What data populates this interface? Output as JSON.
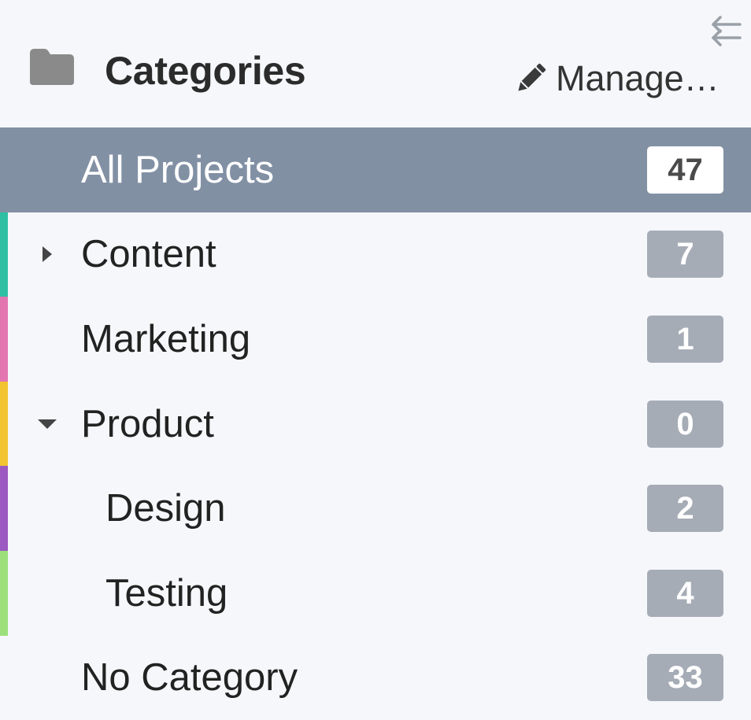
{
  "header": {
    "title": "Categories",
    "manage_label": "Manage…",
    "icons": {
      "folder": "folder-icon",
      "pencil": "pencil-icon",
      "collapse": "collapse-arrows-icon"
    }
  },
  "colors": {
    "background": "#f5f7fa",
    "selected_row": "#8290a4",
    "badge": "#a6acb6",
    "selected_badge": "#ffffff",
    "content": "#2fc0a3",
    "marketing": "#e376b0",
    "product": "#f2c431",
    "design": "#9b59c1",
    "testing": "#9be07a"
  },
  "categories": [
    {
      "label": "All Projects",
      "count": "47",
      "selected": true
    },
    {
      "label": "Content",
      "count": "7",
      "caret": "collapsed"
    },
    {
      "label": "Marketing",
      "count": "1"
    },
    {
      "label": "Product",
      "count": "0",
      "caret": "expanded"
    },
    {
      "label": "Design",
      "count": "2"
    },
    {
      "label": "Testing",
      "count": "4"
    },
    {
      "label": "No Category",
      "count": "33"
    }
  ]
}
